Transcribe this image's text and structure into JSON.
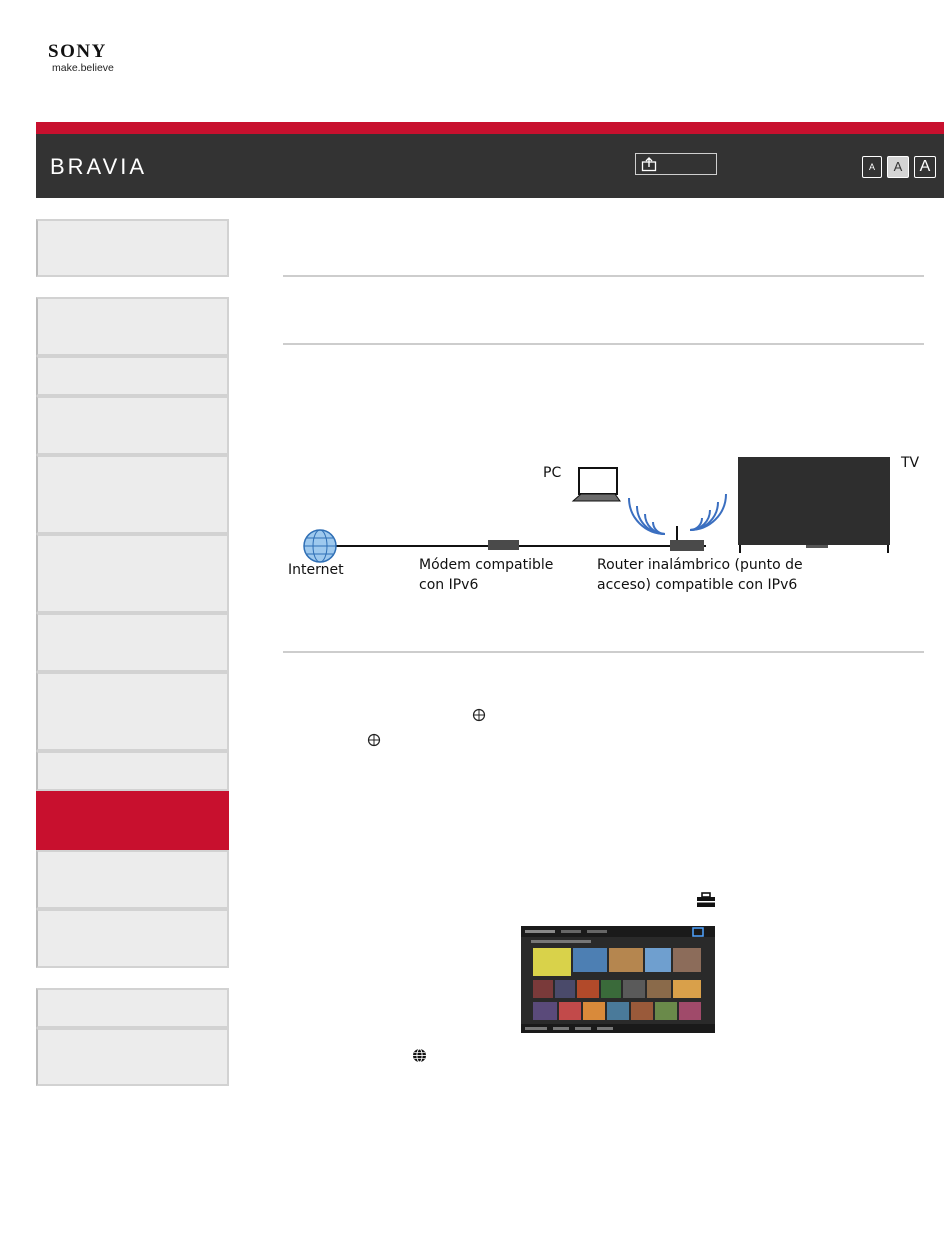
{
  "brand": {
    "company": "SONY",
    "tagline": "make.believe",
    "product": "BRAVIA"
  },
  "header": {
    "share_icon": "share-icon",
    "font_sizes": [
      "A",
      "A",
      "A"
    ],
    "active_font_size_index": 1
  },
  "colors": {
    "accent_red": "#c8102e",
    "header_bg": "#333333",
    "nav_bg": "#ececec",
    "nav_border": "#d2d2d2"
  },
  "sidebar": {
    "active_index": 9
  },
  "diagram": {
    "labels": {
      "pc": "PC",
      "tv": "TV",
      "internet": "Internet",
      "modem_line1": "Módem compatible",
      "modem_line2": "con IPv6",
      "router_line1": "Router inalámbrico (punto de",
      "router_line2": "acceso) compatible con IPv6"
    }
  },
  "icons": {
    "step_icon_1": "circle-plus-icon",
    "step_icon_2": "circle-plus-icon",
    "toolbox_icon": "toolbox-icon",
    "globe_icon": "globe-icon"
  }
}
